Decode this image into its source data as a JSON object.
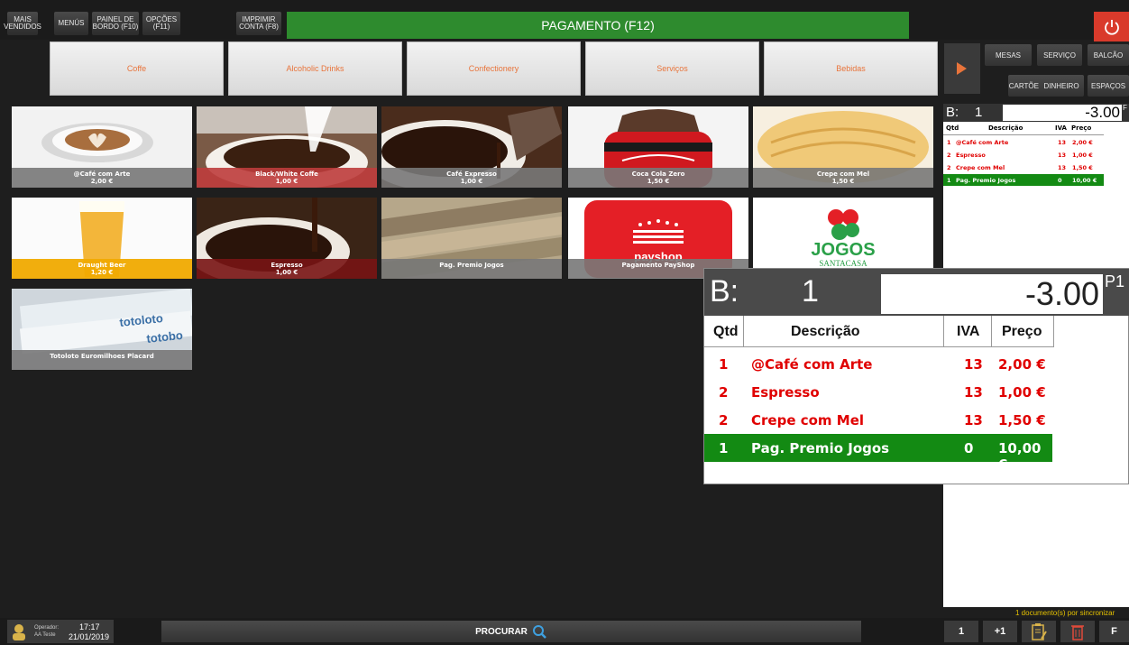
{
  "topbar": {
    "mais_vendidos": "MAIS\nVENDIDOS",
    "menus": "MENÚS",
    "painel": "PAINEL DE\nBORDO (F10)",
    "opcoes": "OPÇÕES\n(F11)",
    "imprimir": "IMPRIMIR\nCONTA (F8)",
    "pagamento": "PAGAMENTO (F12)"
  },
  "categories": [
    "Coffe",
    "Alcoholic Drinks",
    "Confectionery",
    "Serviços",
    "Bebidas"
  ],
  "side_buttons": {
    "mesas": "MESAS",
    "servico": "SERVIÇO",
    "balcao": "BALCÃO",
    "cartoes": "CARTÕES",
    "dinheiro": "DINHEIRO",
    "espacos": "ESPAÇOS"
  },
  "products": [
    {
      "name": "@Café com Arte",
      "price": "2,00 €"
    },
    {
      "name": "Black/White Coffe",
      "price": "1,00 €"
    },
    {
      "name": "Café Expresso",
      "price": "1,00 €"
    },
    {
      "name": "Coca Cola Zero",
      "price": "1,50 €"
    },
    {
      "name": "Crepe com Mel",
      "price": "1,50 €"
    },
    {
      "name": "Draught Beer",
      "price": "1,20 €"
    },
    {
      "name": "Espresso",
      "price": "1,00 €"
    },
    {
      "name": "Pag. Premio Jogos",
      "price": ""
    },
    {
      "name": "Pagamento PayShop",
      "price": ""
    },
    {
      "name": "",
      "price": ""
    },
    {
      "name": "Totoloto Euromilhoes Placard",
      "price": ""
    }
  ],
  "tile_logos": {
    "payshop": "payshop",
    "jogos": "JOGOS",
    "santacasa": "SANTACASA",
    "totoloto": "totoloto",
    "totobola": "totobo"
  },
  "receipt": {
    "label": "B:",
    "number": "1",
    "total": "-3.00",
    "zoom_suffix": "P1",
    "small_suffix": "F",
    "headers": {
      "qtd": "Qtd",
      "desc": "Descrição",
      "iva": "IVA",
      "preco": "Preço"
    },
    "lines": [
      {
        "qtd": "1",
        "desc": "@Café com Arte",
        "iva": "13",
        "preco": "2,00 €"
      },
      {
        "qtd": "2",
        "desc": "Espresso",
        "iva": "13",
        "preco": "1,00 €"
      },
      {
        "qtd": "2",
        "desc": "Crepe com Mel",
        "iva": "13",
        "preco": "1,50 €"
      },
      {
        "qtd": "1",
        "desc": "Pag. Premio Jogos",
        "iva": "0",
        "preco": "10,00 €"
      }
    ]
  },
  "sync_status": "1 documento(s) por sincronizar",
  "footer": {
    "operator_label": "Operador:",
    "operator_name": "AA Teste",
    "time": "17:17",
    "date": "21/01/2019",
    "search": "PROCURAR",
    "qty1": "1",
    "plus1": "+1",
    "f": "F"
  },
  "colors": {
    "green": "#2e8b2e",
    "selected_row": "#138a13",
    "red_text": "#e00000",
    "power": "#d93a2b",
    "category_text": "#e8743b"
  }
}
